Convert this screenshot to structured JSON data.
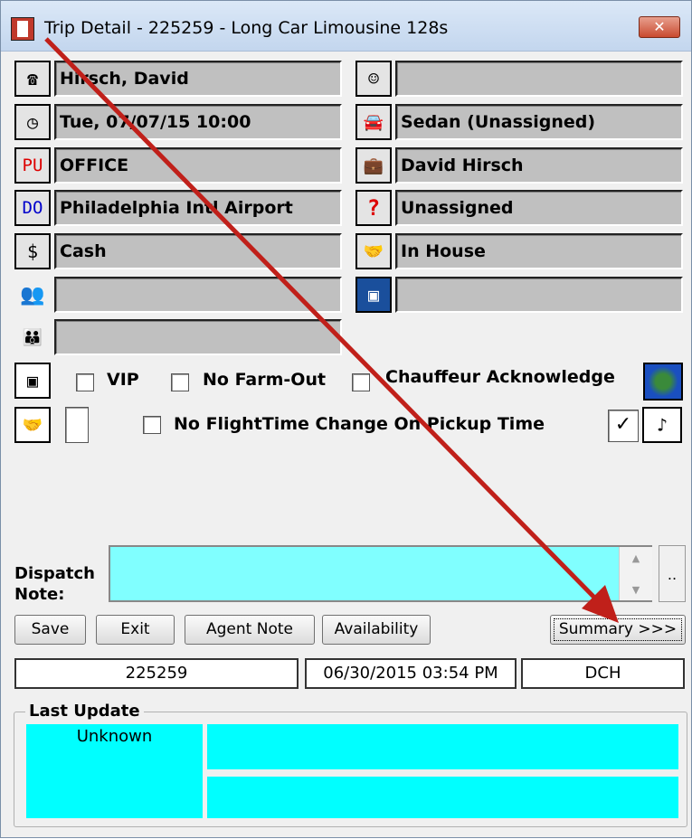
{
  "window": {
    "title": "Trip Detail - 225259 - Long Car Limousine  128s",
    "close_label": "✕"
  },
  "left_fields": [
    {
      "icon": "telephone-icon",
      "glyph": "☎",
      "value": "Hirsch, David"
    },
    {
      "icon": "clock-icon",
      "glyph": "◷",
      "value": "Tue, 07/07/15  10:00"
    },
    {
      "icon": "pu-icon",
      "glyph": "PU",
      "value": "OFFICE"
    },
    {
      "icon": "do-icon",
      "glyph": "DO",
      "value": "Philadelphia Intl Airport"
    },
    {
      "icon": "dollar-icon",
      "glyph": "$",
      "value": "Cash"
    },
    {
      "icon": "passengers-icon",
      "glyph": "👥",
      "value": ""
    },
    {
      "icon": "group-icon",
      "glyph": "👪",
      "value": ""
    }
  ],
  "right_fields": [
    {
      "icon": "chauffeur-icon",
      "glyph": "☺",
      "value": ""
    },
    {
      "icon": "vehicle-icon",
      "glyph": "🚘",
      "value": "Sedan (Unassigned)"
    },
    {
      "icon": "luggage-icon",
      "glyph": "💼",
      "value": "David Hirsch"
    },
    {
      "icon": "question-icon",
      "glyph": "?",
      "value": "Unassigned"
    },
    {
      "icon": "handshake-icon",
      "glyph": "🤝",
      "value": "In House"
    },
    {
      "icon": "card-icon",
      "glyph": "▣",
      "value": ""
    }
  ],
  "checkboxes": {
    "vip": {
      "label": "VIP",
      "checked": false
    },
    "no_farm_out": {
      "label": "No Farm-Out",
      "checked": false
    },
    "chauffeur_ack": {
      "label": "Chauffeur Acknowledge",
      "checked": false
    },
    "no_flighttime": {
      "label": "No FlightTime Change On Pickup Time",
      "checked": false
    },
    "right_checked": {
      "checked": true
    }
  },
  "music_glyph": "♪",
  "dispatch": {
    "label_line1": "Dispatch",
    "label_line2": "Note:",
    "value": "",
    "ellipsis": ".."
  },
  "buttons": {
    "save": "Save",
    "exit": "Exit",
    "agent_note": "Agent Note",
    "availability": "Availability",
    "summary": "Summary >>>"
  },
  "info": {
    "trip_number": "225259",
    "created": "06/30/2015 03:54 PM",
    "user": "DCH"
  },
  "last_update": {
    "title": "Last Update",
    "value": "Unknown"
  },
  "colors": {
    "cyan": "#00ffff",
    "note_bg": "#80ffff",
    "arrow": "#c0201a"
  }
}
